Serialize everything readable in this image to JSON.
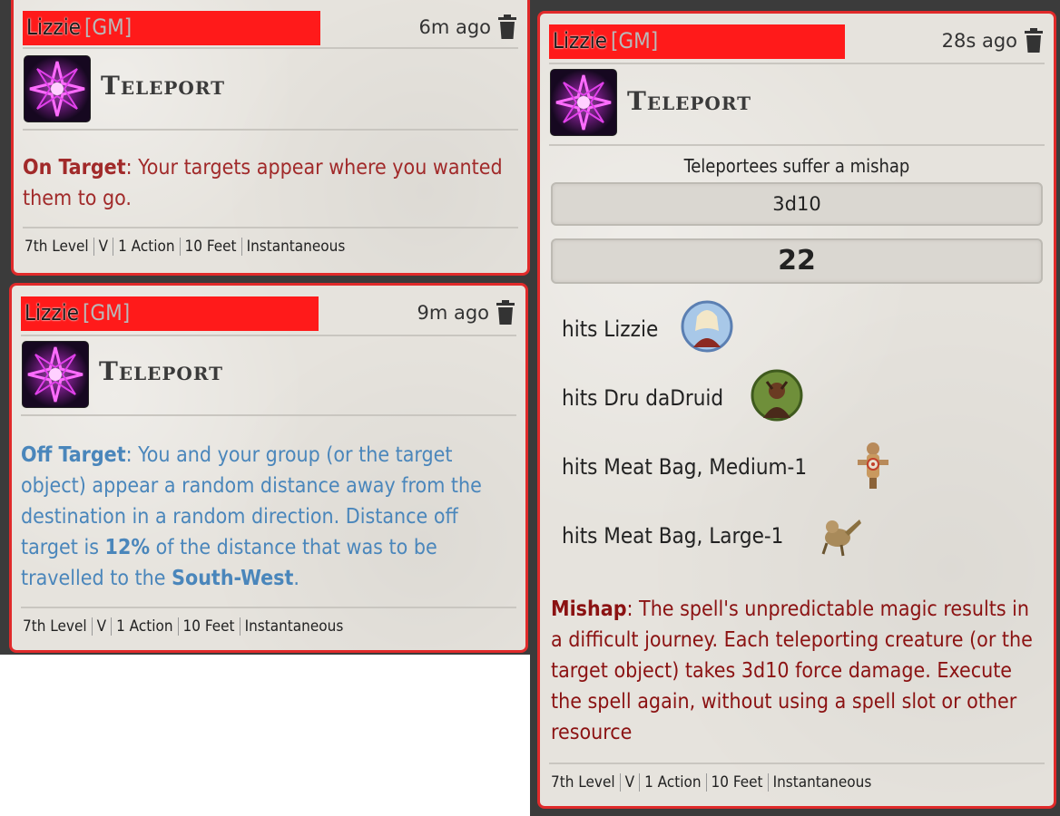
{
  "cards": [
    {
      "user": "Lizzie",
      "role": "[GM]",
      "time": "6m ago",
      "spell": "Teleport",
      "result_label": "On Target",
      "result_text": ": Your targets appear where you wanted them to go.",
      "footer": [
        "7th Level",
        "V",
        "1 Action",
        "10 Feet",
        "Instantaneous"
      ]
    },
    {
      "user": "Lizzie",
      "role": "[GM]",
      "time": "9m ago",
      "spell": "Teleport",
      "result_label": "Off Target",
      "result_text_1": ": You and your group (or the target object) appear a random distance away from the destination in a random direction. Distance off target is ",
      "percent": "12%",
      "result_text_2": " of the distance that was to be travelled to the ",
      "direction": "South-West",
      "result_text_3": ".",
      "footer": [
        "7th Level",
        "V",
        "1 Action",
        "10 Feet",
        "Instantaneous"
      ]
    },
    {
      "user": "Lizzie",
      "role": "[GM]",
      "time": "28s ago",
      "spell": "Teleport",
      "roll_title": "Teleportees suffer a mishap",
      "roll_formula": "3d10",
      "roll_total": "22",
      "hits": [
        {
          "label": "hits Lizzie",
          "token": "lizzie-token"
        },
        {
          "label": "hits Dru daDruid",
          "token": "druid-token"
        },
        {
          "label": "hits Meat Bag, Medium-1",
          "token": "dummy-token"
        },
        {
          "label": "hits Meat Bag, Large-1",
          "token": "creature-token"
        }
      ],
      "result_label": "Mishap",
      "result_text": ": The spell's unpredictable magic results in a difficult journey. Each teleporting creature (or the target object) takes 3d10 force damage. Execute the spell again, without using a spell slot or other resource",
      "footer": [
        "7th Level",
        "V",
        "1 Action",
        "10 Feet",
        "Instantaneous"
      ]
    }
  ],
  "colors": {
    "border": "#e02a2a",
    "name_bar": "#ff1a1a",
    "on_target": "#a12a2a",
    "off_target": "#4a86bb",
    "mishap": "#8b1212"
  }
}
